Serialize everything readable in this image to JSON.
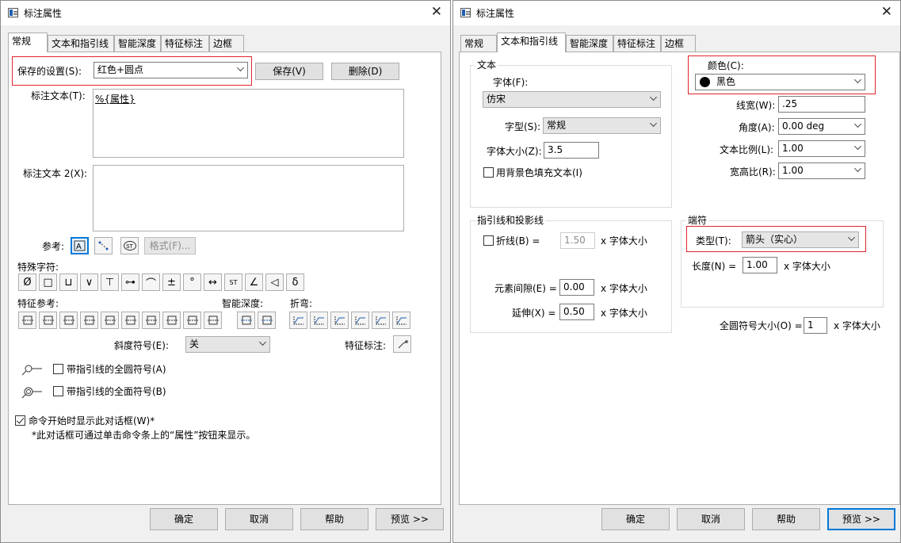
{
  "left": {
    "title": "标注属性",
    "tabs": [
      "常规",
      "文本和指引线",
      "智能深度",
      "特征标注",
      "边框"
    ],
    "saved_settings_label": "保存的设置(S):",
    "saved_settings_value": "红色+圆点",
    "save_button": "保存(V)",
    "delete_button": "删除(D)",
    "text_label": "标注文本(T):",
    "text_value": "%{属性}",
    "text2_label": "标注文本 2(X):",
    "text2_value": "",
    "reference_label": "参考:",
    "format_button": "格式(F)...",
    "special_chars_label": "特殊字符:",
    "special_chars": [
      "Ø",
      "□",
      "⊔",
      "∨",
      "⊤",
      "⊶",
      "⌒",
      "±",
      "°",
      "↔",
      "ST",
      "∠",
      "◁",
      "δ"
    ],
    "feature_ref_label": "特征参考:",
    "smart_depth_label": "智能深度:",
    "bend_label": "折弯:",
    "taper_label": "斜度符号(E):",
    "taper_value": "关",
    "feature_callout_label": "特征标注:",
    "all_around_label": "带指引线的全圆符号(A)",
    "all_over_label": "带指引线的全面符号(B)",
    "show_on_start_label": "命令开始时显示此对话框(W)*",
    "note": "*此对话框可通过单击命令条上的“属性”按钮来显示。",
    "buttons": [
      "确定",
      "取消",
      "帮助",
      "预览 >>"
    ]
  },
  "right": {
    "title": "标注属性",
    "tabs": [
      "常规",
      "文本和指引线",
      "智能深度",
      "特征标注",
      "边框"
    ],
    "text_group": "文本",
    "font_label": "字体(F):",
    "font_value": "仿宋",
    "style_label": "字型(S):",
    "style_value": "常规",
    "size_label": "字体大小(Z):",
    "size_value": "3.5",
    "fill_bg_label": "用背景色填充文本(I)",
    "color_label": "颜色(C):",
    "color_value": "黑色",
    "color_hex": "#000000",
    "line_width_label": "线宽(W):",
    "line_width_value": ".25",
    "angle_label": "角度(A):",
    "angle_value": "0.00 deg",
    "text_scale_label": "文本比例(L):",
    "text_scale_value": "1.00",
    "aspect_label": "宽高比(R):",
    "aspect_value": "1.00",
    "leader_group": "指引线和投影线",
    "break_label": "折线(B) =",
    "break_value": "1.50",
    "gap_label": "元素间隙(E) =",
    "gap_value": "0.00",
    "extension_label": "延伸(X) =",
    "extension_value": "0.50",
    "unit_text": "x 字体大小",
    "terminator_group": "端符",
    "type_label": "类型(T):",
    "type_value": "箭头（实心）",
    "length_label": "长度(N) =",
    "length_value": "1.00",
    "all_around_size_label": "全圆符号大小(O) =",
    "all_around_size_value": "1",
    "buttons": [
      "确定",
      "取消",
      "帮助",
      "预览 >>"
    ]
  }
}
